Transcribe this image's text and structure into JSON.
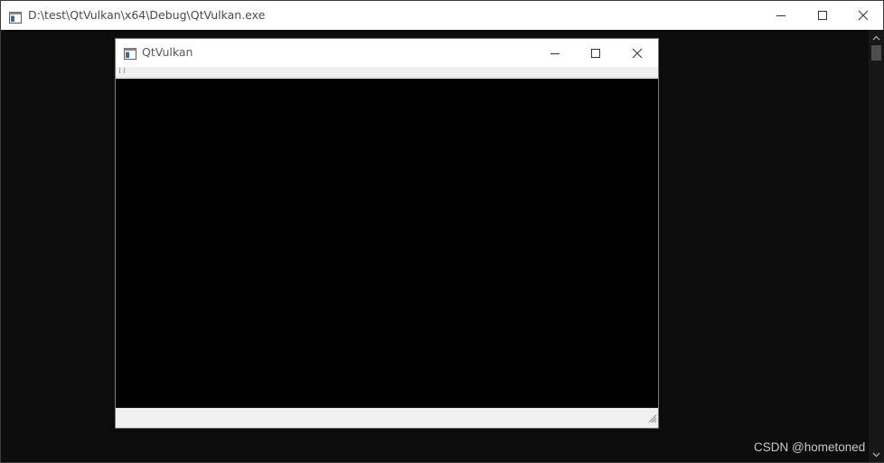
{
  "console_window": {
    "title": "D:\\test\\QtVulkan\\x64\\Debug\\QtVulkan.exe"
  },
  "qt_window": {
    "title": "QtVulkan",
    "menubar_grip": "⠇⠇"
  },
  "watermark": "CSDN @hometoned",
  "icons": {
    "console_app": "console-window-icon",
    "qt_app": "application-window-icon",
    "minimize": "minimize-icon",
    "maximize": "maximize-icon",
    "close": "close-icon",
    "scroll_up": "chevron-up-icon",
    "scroll_down": "chevron-down-icon",
    "size_grip": "resize-grip-icon"
  },
  "colors": {
    "console_bg": "#0c0c0c",
    "surface_bg": "#000000",
    "titlebar_bg": "#ffffff",
    "chrome_bg": "#f0f0f0"
  }
}
